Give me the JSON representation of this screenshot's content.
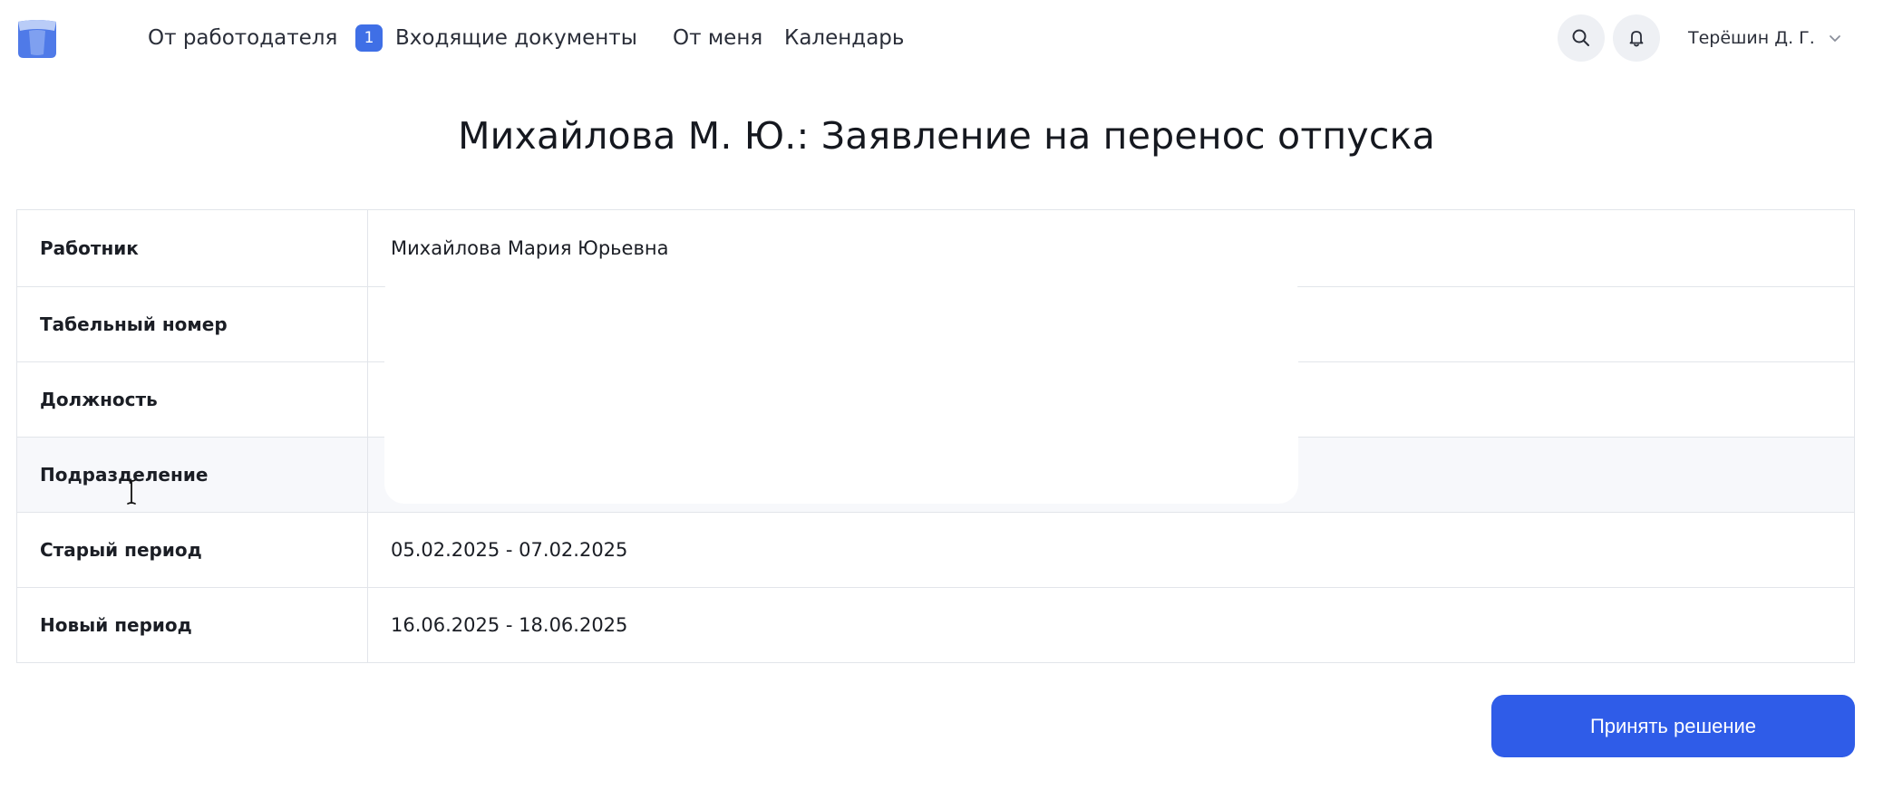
{
  "header": {
    "nav": [
      {
        "label": "От работодателя"
      },
      {
        "label": "Входящие документы",
        "badge": "1"
      },
      {
        "label": "От меня"
      },
      {
        "label": "Календарь"
      }
    ],
    "search_icon": "search-icon",
    "bell_icon": "bell-icon",
    "user_name": "Терёшин Д. Г."
  },
  "page": {
    "title": "Михайлова М. Ю.: Заявление на перенос отпуска"
  },
  "details": [
    {
      "label": "Работник",
      "value": "Михайлова Мария Юрьевна"
    },
    {
      "label": "Табельный номер",
      "value": ""
    },
    {
      "label": "Должность",
      "value": ""
    },
    {
      "label": "Подразделение",
      "value": ""
    },
    {
      "label": "Старый период",
      "value": "05.02.2025 - 07.02.2025"
    },
    {
      "label": "Новый период",
      "value": "16.06.2025 - 18.06.2025"
    }
  ],
  "actions": {
    "decide_label": "Принять решение"
  },
  "colors": {
    "accent": "#2f5ce8",
    "badge": "#3f6fe6"
  }
}
